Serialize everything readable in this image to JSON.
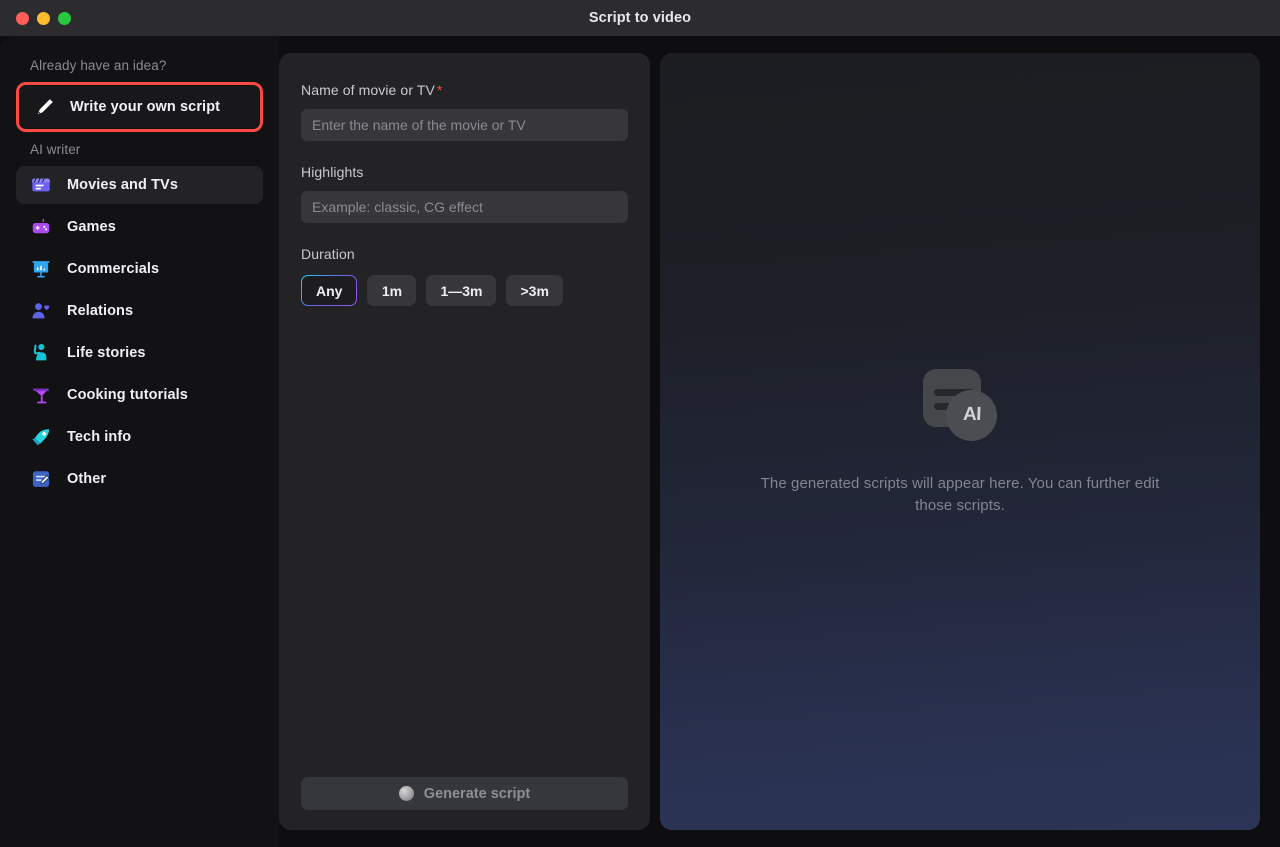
{
  "window": {
    "title": "Script to video",
    "traffic_lights": [
      {
        "name": "close",
        "color": "#ff5f57"
      },
      {
        "name": "minimize",
        "color": "#febc2e"
      },
      {
        "name": "zoom",
        "color": "#28c840"
      }
    ]
  },
  "sidebar": {
    "idea_heading": "Already have an idea?",
    "write_own_script": {
      "label": "Write your own script",
      "icon": "pencil-icon",
      "annotation_color": "#fb4a46"
    },
    "ai_writer_heading": "AI writer",
    "items": [
      {
        "label": "Movies and TVs",
        "icon": "clapperboard-icon",
        "color": "#6b62f0",
        "active": true
      },
      {
        "label": "Games",
        "icon": "gamepad-icon",
        "color": "#a94bf0",
        "active": false
      },
      {
        "label": "Commercials",
        "icon": "presentation-icon",
        "color": "#2fa6f0",
        "active": false
      },
      {
        "label": "Relations",
        "icon": "person-heart-icon",
        "color": "#5f62e8",
        "active": false
      },
      {
        "label": "Life stories",
        "icon": "person-wave-icon",
        "color": "#16c5d4",
        "active": false
      },
      {
        "label": "Cooking tutorials",
        "icon": "cocktail-icon",
        "color": "#b246ef",
        "active": false
      },
      {
        "label": "Tech info",
        "icon": "rocket-icon",
        "color": "#2ad3e0",
        "active": false
      },
      {
        "label": "Other",
        "icon": "note-edit-icon",
        "color": "#3b63c8",
        "active": false
      }
    ]
  },
  "form": {
    "name_label": "Name of movie or TV",
    "name_required_mark": "*",
    "name_value": "",
    "name_placeholder": "Enter the name of the movie or TV",
    "highlights_label": "Highlights",
    "highlights_value": "",
    "highlights_placeholder": "Example: classic, CG effect",
    "duration_label": "Duration",
    "duration_options": [
      {
        "label": "Any",
        "selected": true
      },
      {
        "label": "1m",
        "selected": false
      },
      {
        "label": "1—3m",
        "selected": false
      },
      {
        "label": ">3m",
        "selected": false
      }
    ],
    "generate_button": {
      "label": "Generate script",
      "icon": "sphere-icon",
      "disabled": true
    }
  },
  "preview": {
    "icon": "ai-document-icon",
    "ai_badge_text": "AI",
    "hint": "The generated scripts will appear here. You can further edit those scripts."
  },
  "colors": {
    "accent_gradient_start": "#2ec9f5",
    "accent_gradient_end": "#9b53ef",
    "required_star": "#f0463c",
    "annotation": "#fb4a46"
  }
}
